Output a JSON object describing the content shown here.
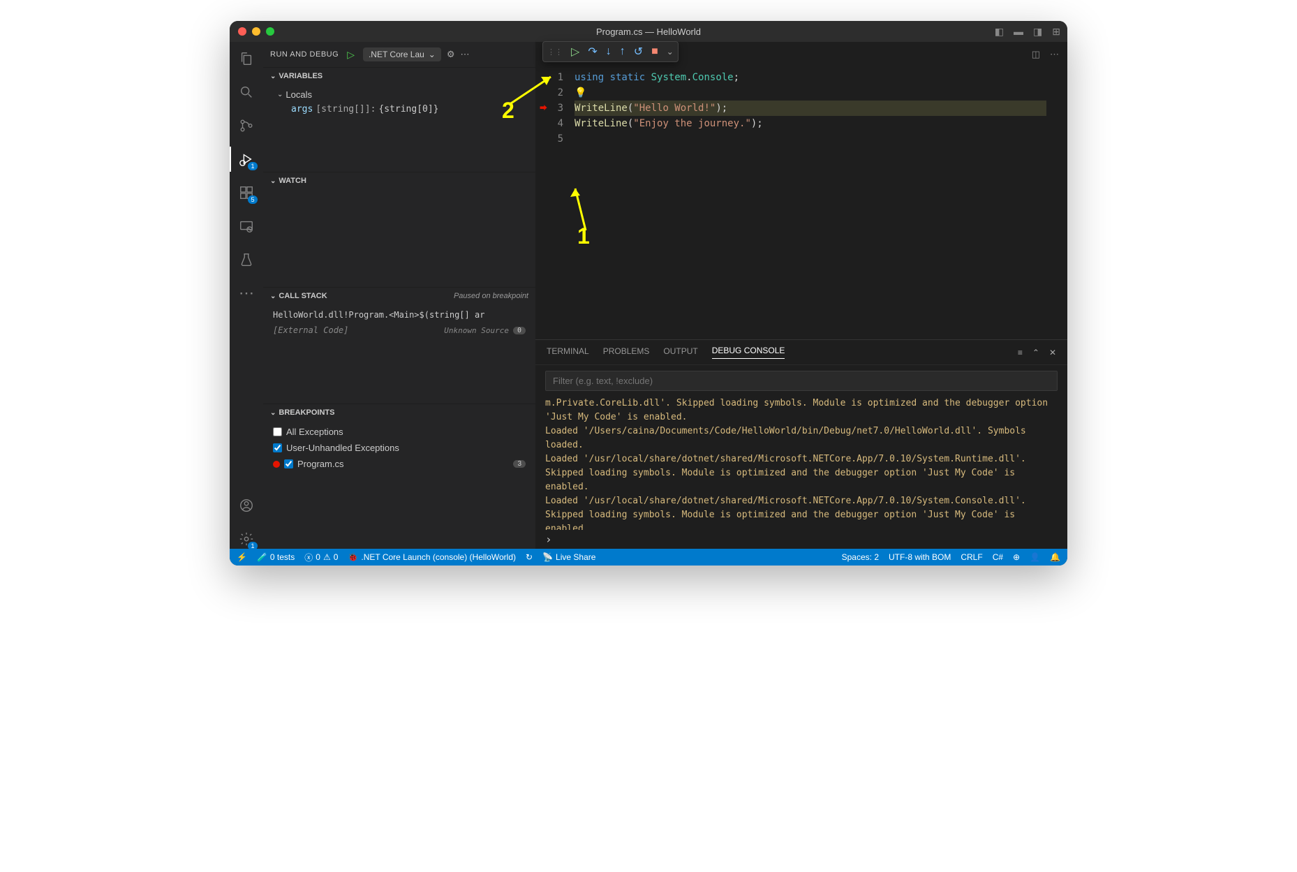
{
  "window": {
    "title": "Program.cs — HelloWorld"
  },
  "sidebar": {
    "header": "RUN AND DEBUG",
    "config": ".NET Core Lau",
    "variables": {
      "title": "VARIABLES",
      "locals": "Locals",
      "entry": {
        "name": "args",
        "type": "[string[]]:",
        "value": "{string[0]}"
      }
    },
    "watch": {
      "title": "WATCH"
    },
    "callstack": {
      "title": "CALL STACK",
      "status": "Paused on breakpoint",
      "frame": "HelloWorld.dll!Program.<Main>$(string[]  ar",
      "external": "[External Code]",
      "unknown": "Unknown Source",
      "unknown_badge": "0"
    },
    "breakpoints": {
      "title": "BREAKPOINTS",
      "all_ex": "All Exceptions",
      "user_ex": "User-Unhandled Exceptions",
      "file": "Program.cs",
      "line_badge": "3"
    }
  },
  "activity": {
    "debug_badge": "1",
    "ext_badge": "5",
    "gear_badge": "1"
  },
  "tab": {
    "lang": "C#",
    "name": "Program.cs"
  },
  "code": {
    "lines": [
      "1",
      "2",
      "3",
      "4",
      "5"
    ],
    "l1": {
      "a": "using ",
      "b": "static ",
      "c": "System",
      "d": ".",
      "e": "Console",
      "f": ";"
    },
    "l3": {
      "fn": "WriteLine",
      "p1": "(",
      "s": "\"Hello World!\"",
      "p2": ");"
    },
    "l4": {
      "fn": "WriteLine",
      "p1": "(",
      "s": "\"Enjoy the journey.\"",
      "p2": ");"
    }
  },
  "panel": {
    "tabs": {
      "terminal": "TERMINAL",
      "problems": "PROBLEMS",
      "output": "OUTPUT",
      "debug": "DEBUG CONSOLE"
    },
    "filter_placeholder": "Filter (e.g. text, !exclude)",
    "lines": [
      "m.Private.CoreLib.dll'. Skipped loading symbols. Module is optimized and the debugger option 'Just My Code' is enabled.",
      "Loaded '/Users/caina/Documents/Code/HelloWorld/bin/Debug/net7.0/HelloWorld.dll'. Symbols loaded.",
      "Loaded '/usr/local/share/dotnet/shared/Microsoft.NETCore.App/7.0.10/System.Runtime.dll'. Skipped loading symbols. Module is optimized and the debugger option 'Just My Code' is enabled.",
      "Loaded '/usr/local/share/dotnet/shared/Microsoft.NETCore.App/7.0.10/System.Console.dll'. Skipped loading symbols. Module is optimized and the debugger option 'Just My Code' is enabled."
    ]
  },
  "status": {
    "tests": "0 tests",
    "err": "0",
    "warn": "0",
    "launch": ".NET Core Launch (console) (HelloWorld)",
    "live": "Live Share",
    "spaces": "Spaces: 2",
    "enc": "UTF-8 with BOM",
    "eol": "CRLF",
    "lang": "C#"
  },
  "annotations": {
    "one": "1",
    "two": "2"
  }
}
